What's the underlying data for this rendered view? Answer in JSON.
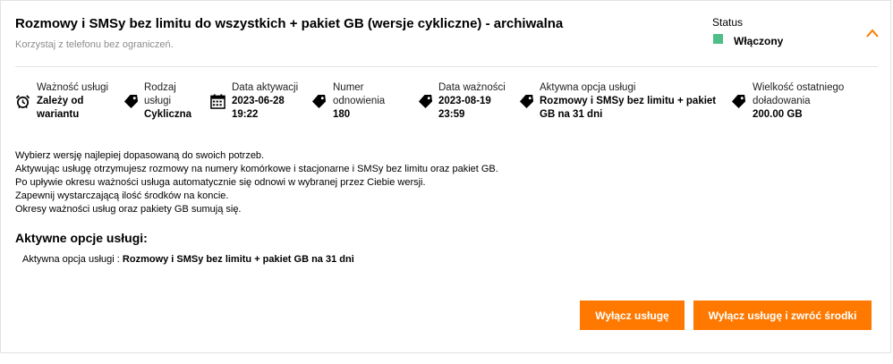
{
  "header": {
    "title": "Rozmowy i SMSy bez limitu do wszystkich + pakiet GB (wersje cykliczne) - archiwalna",
    "subtitle": "Korzystaj z telefonu bez ograniczeń.",
    "status_label": "Status",
    "status_value": "Włączony",
    "status_color": "#50be87",
    "accent_color": "#ff7900"
  },
  "info": [
    {
      "label": "Ważność usługi",
      "value": "Zależy od wariantu",
      "icon": "alarm-clock-icon"
    },
    {
      "label": "Rodzaj usługi",
      "value": "Cykliczna",
      "icon": "tag-icon"
    },
    {
      "label": "Data aktywacji",
      "value": "2023-06-28 19:22",
      "icon": "calendar-icon"
    },
    {
      "label": "Numer odnowienia",
      "value": "180",
      "icon": "tag-icon"
    },
    {
      "label": "Data ważności",
      "value": "2023-08-19 23:59",
      "icon": "tag-icon"
    },
    {
      "label": "Aktywna opcja usługi",
      "value": "Rozmowy i SMSy bez limitu + pakiet GB na 31 dni",
      "icon": "tag-icon"
    },
    {
      "label": "Wielkość ostatniego doładowania",
      "value": "200.00 GB",
      "icon": "tag-icon"
    }
  ],
  "description": [
    "Wybierz wersję najlepiej dopasowaną do swoich potrzeb.",
    "Aktywując usługę otrzymujesz rozmowy na numery komórkowe i stacjonarne i SMSy bez limitu oraz pakiet GB.",
    "Po upływie okresu ważności usługa automatycznie się odnowi w wybranej przez Ciebie wersji.",
    "Zapewnij wystarczającą ilość środków na koncie.",
    "Okresy ważności usług oraz pakiety GB sumują się."
  ],
  "active_options": {
    "title": "Aktywne opcje usługi:",
    "label": "Aktywna opcja usługi :",
    "value": "Rozmowy i SMSy bez limitu + pakiet GB na 31 dni"
  },
  "buttons": {
    "disable": "Wyłącz usługę",
    "disable_refund": "Wyłącz usługę i zwróć środki"
  }
}
